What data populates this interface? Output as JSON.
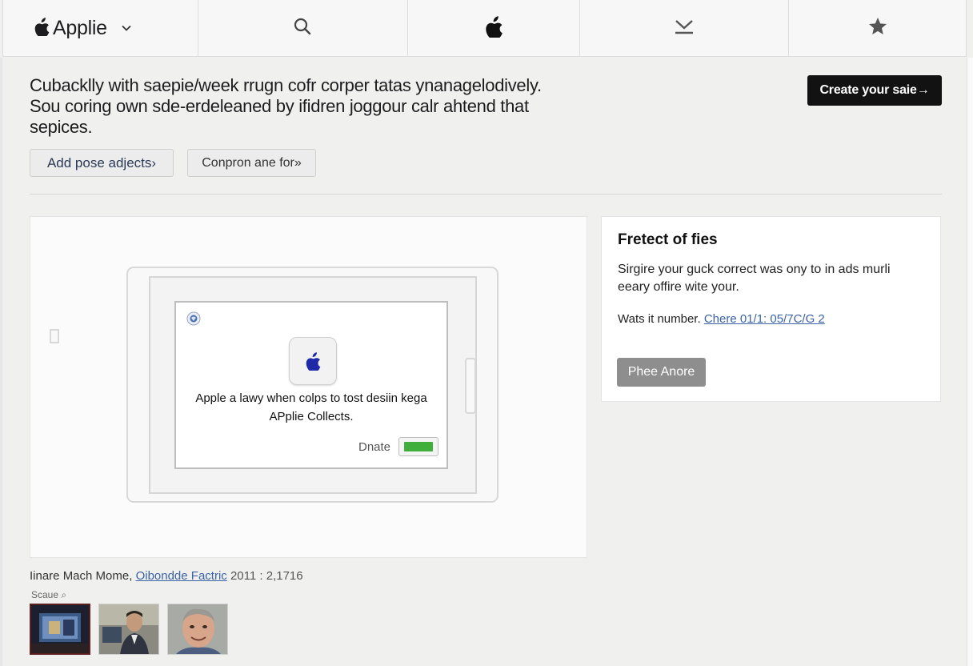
{
  "nav": {
    "brand": "Applie",
    "items": [
      {
        "icon": "search-icon"
      },
      {
        "icon": "apple-logo-icon"
      },
      {
        "icon": "download-icon"
      },
      {
        "icon": "star-icon"
      }
    ]
  },
  "intro": {
    "text": "Cubacklly with saepie/week rrugn cofr corper tatas ynanagelodively. Sou coring own sde-erdeleaned by ifidren joggour calr ahtend that sepices.",
    "cta_label": "Create your saie→",
    "pill_1": "Add pose adjects›",
    "pill_2": "Conpron ane for»"
  },
  "preview": {
    "message_line_1": "Apple a lawy when colps to tost desiin kega",
    "message_line_2": "APplie Collects.",
    "dismiss_label": "Dnate"
  },
  "side": {
    "title": "Fretect of fies",
    "body": "Sirgire your guck correct was ony to in ads murli eeary offire wite your.",
    "meta_prefix": "Wats it number.",
    "meta_link": "Chere 01/1: 05/7C/G 2",
    "button_label": "Phee Anore"
  },
  "caption": {
    "prefix": "Iinare Mach Mome,",
    "link": "Oibondde Factric",
    "date": "2011 : 2,1716"
  },
  "thumbs": {
    "label": "Scaue ⌕"
  },
  "colors": {
    "cta_bg": "#121212",
    "side_button_bg": "#8e8e8e",
    "link": "#3b63a5",
    "toggle_on": "#3fae3b"
  }
}
